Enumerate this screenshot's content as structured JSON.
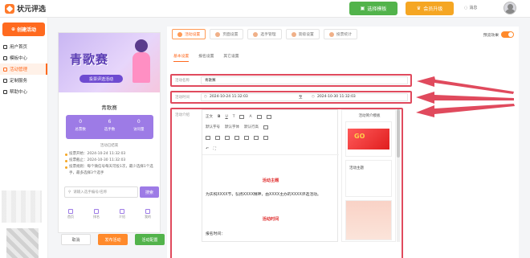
{
  "app": {
    "logo_text": "状元评选",
    "template_btn": "选择模板",
    "vip_btn": "会员升级",
    "messages": "消息"
  },
  "sidebar": {
    "create_btn": "创建活动",
    "items": [
      {
        "label": "用户首页"
      },
      {
        "label": "模板中心"
      },
      {
        "label": "活动管理"
      },
      {
        "label": "定制服务"
      },
      {
        "label": "帮助中心"
      }
    ]
  },
  "preview": {
    "banner_title": "青歌赛",
    "banner_tag": "投票评选活动",
    "name": "青歌赛",
    "stats": [
      {
        "value": "0",
        "label": "总票数"
      },
      {
        "value": "6",
        "label": "选手数"
      },
      {
        "value": "0",
        "label": "访问量"
      }
    ],
    "countdown": "活动已结束",
    "rules": [
      "投票开始：2024-10-24 11:32:03",
      "投票截止：2024-10-30 11:32:03",
      "投票规则：每个微信号每天可投1次，最少选择1个选手，最多选择3个选手"
    ],
    "search_placeholder": "请输入选手编号/名称",
    "search_btn": "搜索",
    "bottom_nav": [
      "首页",
      "排名",
      "介绍",
      "我的"
    ]
  },
  "actions": {
    "cancel": "取消",
    "publish": "发布活动",
    "save": "活动配置"
  },
  "panel": {
    "steps": [
      "活动设置",
      "页面设置",
      "选手管理",
      "高级设置",
      "投票统计"
    ],
    "preview_effect": "预览效果",
    "subtabs": [
      "基本设置",
      "报名设置",
      "其它设置"
    ],
    "name_label": "活动名称",
    "name_value": "青歌赛",
    "time_label": "活动时间",
    "start_time": "2024-10-24 11:32:03",
    "time_sep": "至",
    "end_time": "2024-10-30 11:32:03",
    "intro_label": "活动介绍",
    "toolbar_row1": [
      "正文",
      "B",
      "U",
      "T",
      "A"
    ],
    "toolbar_row2": [
      "默认字号",
      "默认字体",
      "默认行高"
    ],
    "editor_heading1": "活动主题",
    "editor_para1": "为庆祝XXXX节，弘扬XXXX精神，由XXXX主办的XXXX评选活动。",
    "editor_heading2": "活动时间",
    "editor_time_label": "报名时间：",
    "template_panel_title": "活动简介模板",
    "template_items": [
      "活动主题"
    ]
  },
  "colors": {
    "accent": "#ff6a1f",
    "green": "#52b34b",
    "purple": "#9d7be6",
    "highlight": "#e04a5d"
  }
}
